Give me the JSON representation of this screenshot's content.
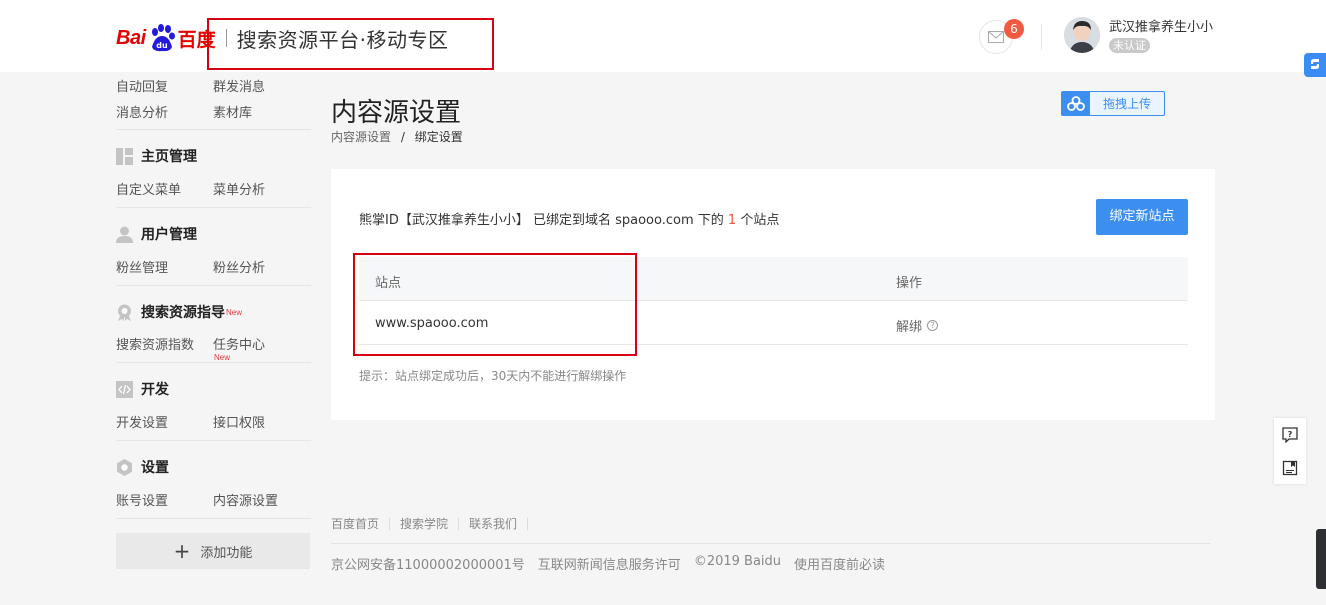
{
  "header": {
    "logo_text": "Bai",
    "logo_text2": "百度",
    "platform_title": "搜索资源平台·移动专区",
    "mail_count": "6",
    "username": "武汉推拿养生小小",
    "verify_status": "未认证"
  },
  "sidebar": {
    "top_rows": [
      [
        "自动回复",
        "群发消息"
      ],
      [
        "消息分析",
        "素材库"
      ]
    ],
    "sections": [
      {
        "title": "主页管理",
        "items": [
          "自定义菜单",
          "菜单分析"
        ]
      },
      {
        "title": "用户管理",
        "items": [
          "粉丝管理",
          "粉丝分析"
        ]
      },
      {
        "title": "搜索资源指导",
        "title_badge": "New",
        "items": [
          "搜索资源指数",
          "任务中心"
        ],
        "item_badge": "New"
      },
      {
        "title": "开发",
        "items": [
          "开发设置",
          "接口权限"
        ]
      },
      {
        "title": "设置",
        "items": [
          "账号设置",
          "内容源设置"
        ]
      }
    ],
    "add_function": "添加功能"
  },
  "main": {
    "page_title": "内容源设置",
    "breadcrumb": {
      "parent": "内容源设置",
      "sep": "/",
      "current": "绑定设置"
    },
    "upload_label": "拖拽上传",
    "info": {
      "prefix": "熊掌ID【武汉推拿养生小小】 已绑定到域名 spaooo.com 下的 ",
      "count": "1",
      "suffix": " 个站点"
    },
    "bind_new_button": "绑定新站点",
    "table": {
      "headers": [
        "站点",
        "操作"
      ],
      "rows": [
        {
          "site": "www.spaooo.com",
          "action": "解绑"
        }
      ]
    },
    "tip": "提示：站点绑定成功后，30天内不能进行解绑操作"
  },
  "footer": {
    "links": [
      "百度首页",
      "搜索学院",
      "联系我们"
    ],
    "copyright": [
      "京公网安备11000002000001号",
      "互联网新闻信息服务许可",
      "©2019 Baidu",
      "使用百度前必读"
    ]
  },
  "colors": {
    "brand_red": "#e10601",
    "primary_blue": "#3c8ff0",
    "badge_orange": "#f15a40",
    "annotation_red": "#d7000f"
  }
}
